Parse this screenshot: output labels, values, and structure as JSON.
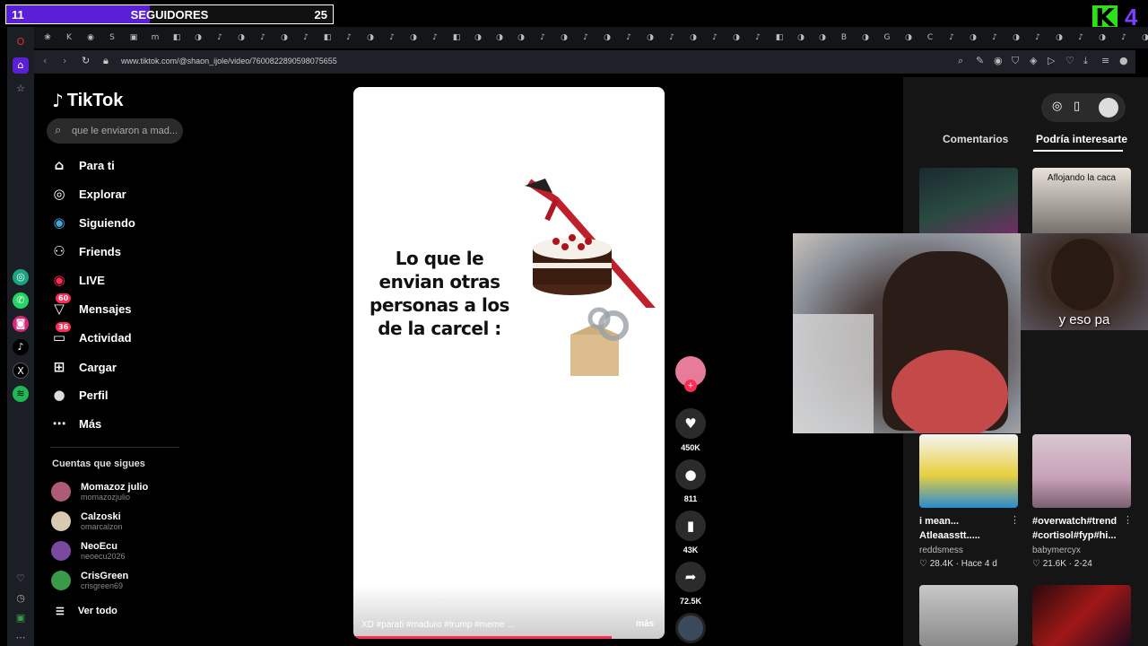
{
  "overlay": {
    "follow_current": "11",
    "follow_label": "SEGUIDORES",
    "follow_goal": "25",
    "follow_progress": 0.44,
    "logo_letter": "K",
    "logo_number": "4"
  },
  "browser": {
    "active_tab": "(99+",
    "url": "www.tiktok.com/@shaon_ijole/video/7600822890598075655"
  },
  "tiktok": {
    "brand": "TikTok",
    "search_value": "que le enviaron a mad...",
    "nav": [
      {
        "label": "Para ti",
        "icon": "home-icon"
      },
      {
        "label": "Explorar",
        "icon": "compass-icon"
      },
      {
        "label": "Siguiendo",
        "icon": "following-avatar-icon"
      },
      {
        "label": "Friends",
        "icon": "friends-icon"
      },
      {
        "label": "LIVE",
        "icon": "live-icon"
      },
      {
        "label": "Mensajes",
        "icon": "messages-icon",
        "badge": "60"
      },
      {
        "label": "Actividad",
        "icon": "activity-icon",
        "badge": "36"
      },
      {
        "label": "Cargar",
        "icon": "upload-icon"
      },
      {
        "label": "Perfil",
        "icon": "profile-icon"
      },
      {
        "label": "Más",
        "icon": "more-icon"
      }
    ],
    "following_heading": "Cuentas que sigues",
    "following": [
      {
        "name": "Momazoz julio",
        "handle": "momazozjulio",
        "color": "#b05a7a"
      },
      {
        "name": "Calzoski",
        "handle": "omarcalzon",
        "color": "#d8c9b0"
      },
      {
        "name": "NeoEcu",
        "handle": "neoecu2026",
        "color": "#7a4aa0"
      },
      {
        "name": "CrisGreen",
        "handle": "crisgreen69",
        "color": "#3a9a4a"
      }
    ],
    "see_all": "Ver todo"
  },
  "video": {
    "caption": "Lo que le envian otras personas a los de la carcel :",
    "author": "shaon_ijole · 1-29",
    "description": "XD #parati #maduro #trump #meme ...",
    "more": "más",
    "progress": 0.83
  },
  "actions": {
    "likes": "450K",
    "comments": "811",
    "saves": "43K",
    "shares": "72.5K"
  },
  "right_panel": {
    "tab_comments": "Comentarios",
    "tab_interest": "Podría interesarte",
    "thumb2_overlay": "Aflojando la caca",
    "cards": [
      {
        "title": "i mean... Atleaasstt.....",
        "user": "reddsmess",
        "stats": "♡ 28.4K · Hace 4 d"
      },
      {
        "title": "#overwatch#trend #cortisol#fyp#hi...",
        "user": "babymercyx",
        "stats": "♡ 21.6K · 2-24"
      }
    ]
  },
  "webcam": {
    "small_caption": "y eso pa"
  }
}
